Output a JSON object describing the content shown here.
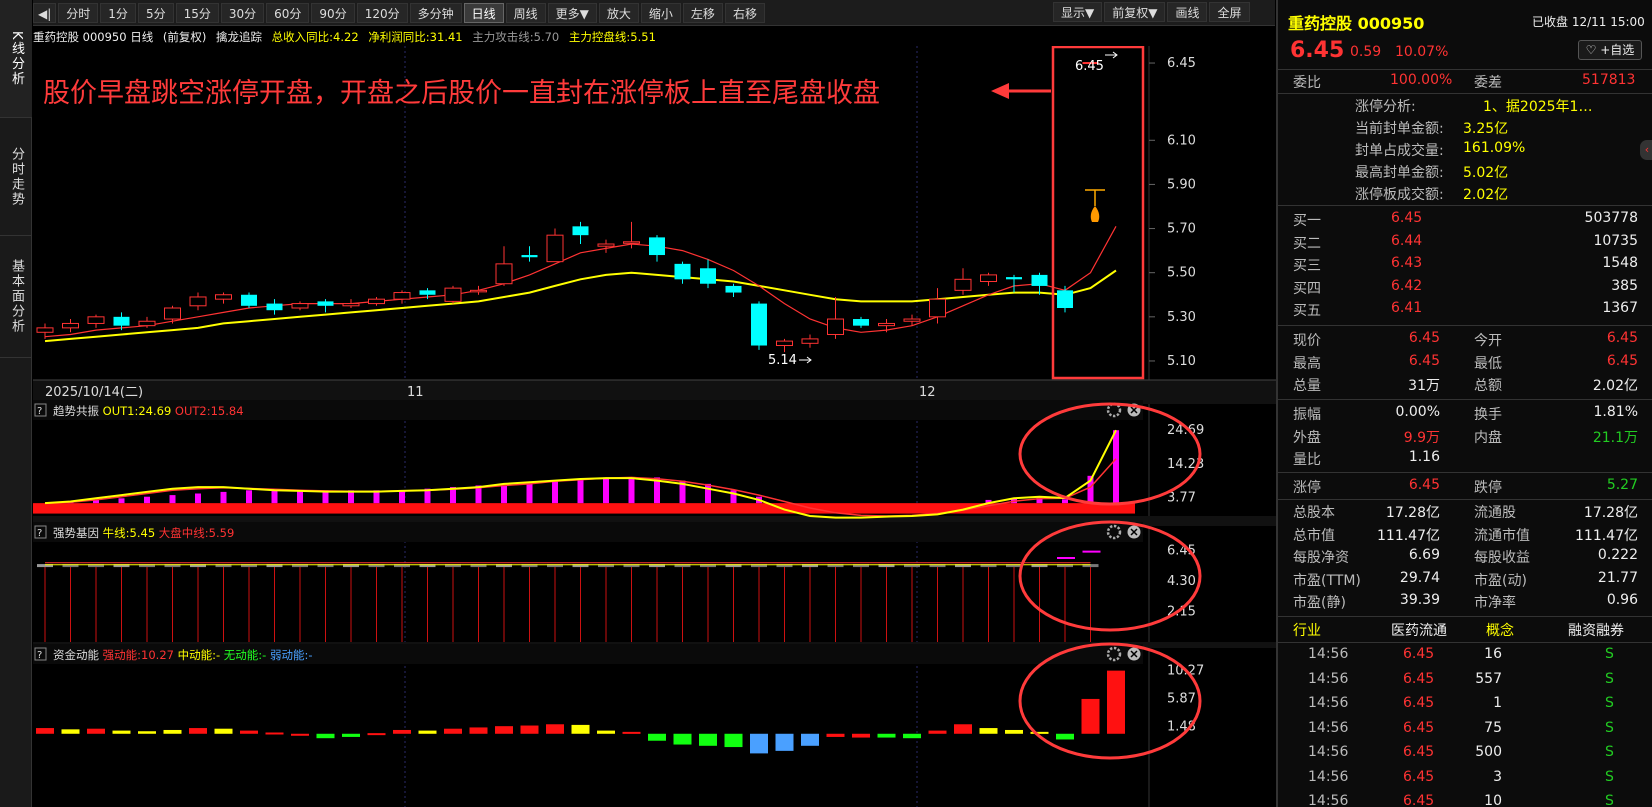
{
  "left_tabs": [
    "K线分析",
    "分时走势",
    "基本面分析"
  ],
  "toolbar": {
    "items": [
      "分时",
      "1分",
      "5分",
      "15分",
      "30分",
      "60分",
      "90分",
      "120分",
      "多分钟",
      "日线",
      "周线",
      "更多▼",
      "放大",
      "缩小",
      "左移",
      "右移"
    ],
    "active": "日线",
    "right_items": [
      "显示▼",
      "前复权▼",
      "画线",
      "全屏"
    ]
  },
  "info_bar": {
    "stock": "重药控股 000950 日线",
    "adjust": "(前复权)",
    "indicator": "擒龙追踪",
    "revenue_yoy": "总收入同比:4.22",
    "profit_yoy": "净利润同比:31.41",
    "attack_line": "主力攻击线:5.70",
    "control_line": "主力控盘线:5.51"
  },
  "annotation": "股价早盘跳空涨停开盘，开盘之后股价一直封在涨停板上直至尾盘收盘",
  "colors": {
    "up": "#ff3333",
    "down": "#00ffff",
    "ma_fast": "#ff3333",
    "ma_slow": "#ffff00",
    "annotation": "#ff3b3b",
    "magenta": "#ff00ff",
    "background": "#000000"
  },
  "chart_data": [
    {
      "type": "candlestick",
      "title": "重药控股 000950 日线",
      "x_labels": [
        "2025/10/14(二)",
        "11",
        "12"
      ],
      "y_ticks": [
        6.45,
        6.1,
        5.9,
        5.7,
        5.5,
        5.3,
        5.1
      ],
      "ylim": [
        5.05,
        6.5
      ],
      "low_label": "5.14",
      "high_label": "6.45",
      "candles": [
        [
          5.23,
          5.25,
          5.2,
          5.27
        ],
        [
          5.25,
          5.27,
          5.23,
          5.29
        ],
        [
          5.27,
          5.3,
          5.25,
          5.31
        ],
        [
          5.3,
          5.26,
          5.24,
          5.32
        ],
        [
          5.26,
          5.28,
          5.25,
          5.3
        ],
        [
          5.29,
          5.34,
          5.27,
          5.35
        ],
        [
          5.35,
          5.39,
          5.33,
          5.41
        ],
        [
          5.38,
          5.4,
          5.36,
          5.41
        ],
        [
          5.4,
          5.35,
          5.34,
          5.41
        ],
        [
          5.36,
          5.33,
          5.31,
          5.38
        ],
        [
          5.34,
          5.36,
          5.33,
          5.37
        ],
        [
          5.37,
          5.35,
          5.32,
          5.38
        ],
        [
          5.35,
          5.36,
          5.34,
          5.38
        ],
        [
          5.36,
          5.38,
          5.35,
          5.39
        ],
        [
          5.38,
          5.41,
          5.36,
          5.42
        ],
        [
          5.42,
          5.4,
          5.38,
          5.43
        ],
        [
          5.37,
          5.43,
          5.36,
          5.44
        ],
        [
          5.42,
          5.42,
          5.4,
          5.44
        ],
        [
          5.45,
          5.54,
          5.44,
          5.62
        ],
        [
          5.58,
          5.57,
          5.55,
          5.62
        ],
        [
          5.55,
          5.67,
          5.55,
          5.7
        ],
        [
          5.71,
          5.67,
          5.63,
          5.73
        ],
        [
          5.62,
          5.63,
          5.59,
          5.65
        ],
        [
          5.64,
          5.64,
          5.61,
          5.73
        ],
        [
          5.66,
          5.58,
          5.55,
          5.67
        ],
        [
          5.54,
          5.47,
          5.45,
          5.55
        ],
        [
          5.52,
          5.45,
          5.43,
          5.56
        ],
        [
          5.44,
          5.41,
          5.39,
          5.45
        ],
        [
          5.36,
          5.17,
          5.15,
          5.37
        ],
        [
          5.17,
          5.19,
          5.14,
          5.2
        ],
        [
          5.18,
          5.2,
          5.16,
          5.22
        ],
        [
          5.22,
          5.29,
          5.2,
          5.39
        ],
        [
          5.29,
          5.26,
          5.25,
          5.3
        ],
        [
          5.26,
          5.27,
          5.23,
          5.29
        ],
        [
          5.28,
          5.29,
          5.26,
          5.31
        ],
        [
          5.3,
          5.38,
          5.27,
          5.43
        ],
        [
          5.42,
          5.47,
          5.4,
          5.52
        ],
        [
          5.46,
          5.49,
          5.44,
          5.5
        ],
        [
          5.48,
          5.47,
          5.41,
          5.49
        ],
        [
          5.49,
          5.44,
          5.4,
          5.5
        ],
        [
          5.42,
          5.34,
          5.32,
          5.44
        ],
        [
          6.45,
          6.45,
          6.45,
          6.45
        ]
      ],
      "ma_fast": [
        5.21,
        5.22,
        5.24,
        5.25,
        5.26,
        5.28,
        5.3,
        5.32,
        5.34,
        5.35,
        5.36,
        5.36,
        5.36,
        5.37,
        5.38,
        5.39,
        5.4,
        5.42,
        5.45,
        5.49,
        5.54,
        5.59,
        5.61,
        5.63,
        5.62,
        5.6,
        5.56,
        5.51,
        5.44,
        5.36,
        5.29,
        5.25,
        5.23,
        5.24,
        5.26,
        5.3,
        5.35,
        5.4,
        5.44,
        5.45,
        5.42,
        5.5,
        5.71
      ],
      "ma_slow": [
        5.19,
        5.2,
        5.21,
        5.22,
        5.23,
        5.24,
        5.25,
        5.27,
        5.28,
        5.29,
        5.3,
        5.31,
        5.32,
        5.33,
        5.34,
        5.35,
        5.36,
        5.37,
        5.39,
        5.41,
        5.44,
        5.47,
        5.49,
        5.5,
        5.49,
        5.48,
        5.47,
        5.46,
        5.44,
        5.42,
        5.4,
        5.38,
        5.37,
        5.37,
        5.37,
        5.38,
        5.39,
        5.4,
        5.41,
        5.41,
        5.4,
        5.43,
        5.51
      ]
    },
    {
      "type": "bar",
      "title": "趋势共振",
      "series": [
        {
          "name": "OUT1",
          "label": "OUT1:24.69"
        },
        {
          "name": "OUT2",
          "label": "OUT2:15.84"
        }
      ],
      "y_ticks": [
        24.69,
        14.23,
        3.77
      ],
      "ylim": [
        -2,
        26
      ],
      "bars": [
        2,
        2.5,
        3,
        3.5,
        4,
        4.5,
        5,
        5.5,
        6,
        6,
        6,
        6,
        6,
        6,
        6,
        6.5,
        7,
        7.5,
        8,
        8.5,
        9,
        9.5,
        10,
        10,
        10,
        9,
        8,
        6,
        4,
        2,
        0,
        0,
        0,
        0,
        0,
        1,
        2,
        3,
        3.5,
        3.8,
        3.2,
        10.5,
        24.69
      ],
      "out1": [
        2,
        2.5,
        3.5,
        4.5,
        5.5,
        6.5,
        7,
        7,
        6.5,
        6,
        5.8,
        5.6,
        5.6,
        5.6,
        5.8,
        6,
        6.5,
        7,
        8,
        8.5,
        9,
        9.5,
        9.8,
        9.8,
        9,
        8,
        6.5,
        5,
        3,
        0,
        -2,
        -2.5,
        -2.5,
        -2.2,
        -2,
        -1.5,
        0,
        2,
        3.5,
        4,
        3.6,
        9,
        24.69
      ],
      "out2": [
        2,
        2.3,
        3,
        4,
        5,
        6,
        6.5,
        6.8,
        6.6,
        6.3,
        6,
        5.8,
        5.7,
        5.7,
        5.8,
        6,
        6.3,
        6.8,
        7.5,
        8,
        8.8,
        9.3,
        9.8,
        10,
        9.6,
        8.8,
        7.6,
        6.2,
        4.5,
        2.5,
        0.5,
        -1,
        -1.8,
        -2,
        -1.8,
        -1.2,
        -0.2,
        1.2,
        2.6,
        3.4,
        3.5,
        7,
        15.84
      ]
    },
    {
      "type": "bar",
      "title": "强势基因",
      "series": [
        {
          "name": "牛线",
          "label": "牛线:5.45"
        },
        {
          "name": "大盘中线",
          "label": "大盘中线:5.59"
        }
      ],
      "y_ticks": [
        6.45,
        4.3,
        2.15
      ],
      "ylim": [
        0,
        7.2
      ]
    },
    {
      "type": "bar",
      "title": "资金动能",
      "series": [
        {
          "name": "强动能",
          "label": "强动能:10.27"
        },
        {
          "name": "中动能",
          "label": "中动能:-"
        },
        {
          "name": "无动能",
          "label": "无动能:-"
        },
        {
          "name": "弱动能",
          "label": "弱动能:-"
        }
      ],
      "y_ticks": [
        10.27,
        5.87,
        1.48
      ],
      "ylim": [
        -4,
        11
      ],
      "bars": [
        1.2,
        1.0,
        1.1,
        0.8,
        0.7,
        0.9,
        1.2,
        1.1,
        0.8,
        0.5,
        0.3,
        -0.4,
        -0.2,
        0.4,
        0.9,
        0.8,
        1.1,
        1.3,
        1.5,
        1.6,
        1.8,
        1.7,
        0.8,
        0.6,
        -0.8,
        -1.4,
        -1.6,
        -1.8,
        -2.8,
        -2.4,
        -1.6,
        -0.2,
        -0.3,
        -0.3,
        -0.4,
        0.8,
        1.8,
        1.2,
        0.9,
        0.6,
        -0.6,
        5.8,
        10.27
      ],
      "bar_colors": [
        "r",
        "y",
        "r",
        "y",
        "y",
        "y",
        "r",
        "y",
        "r",
        "r",
        "r",
        "g",
        "g",
        "r",
        "r",
        "y",
        "r",
        "r",
        "r",
        "r",
        "r",
        "y",
        "y",
        "r",
        "g",
        "g",
        "g",
        "g",
        "b",
        "b",
        "b",
        "r",
        "r",
        "g",
        "g",
        "r",
        "r",
        "y",
        "y",
        "y",
        "g",
        "r",
        "r"
      ]
    }
  ],
  "quote": {
    "name": "重药控股 000950",
    "status": "已收盘 12/11 15:00",
    "price": "6.45",
    "change": "0.59",
    "pct": "10.07%",
    "follow": "+自选",
    "weibi_label": "委比",
    "weibi": "100.00%",
    "weicha_label": "委差",
    "weicha": "517813",
    "limit_analysis": [
      {
        "label": "涨停分析:",
        "value": "1、据2025年1…"
      },
      {
        "label": "当前封单金额:",
        "value": "3.25亿"
      },
      {
        "label": "封单占成交量:",
        "value": "161.09%"
      },
      {
        "label": "最高封单金额:",
        "value": "5.02亿"
      },
      {
        "label": "涨停板成交额:",
        "value": "2.02亿"
      }
    ],
    "bids": [
      {
        "label": "买一",
        "price": "6.45",
        "vol": "503778"
      },
      {
        "label": "买二",
        "price": "6.44",
        "vol": "10735"
      },
      {
        "label": "买三",
        "price": "6.43",
        "vol": "1548"
      },
      {
        "label": "买四",
        "price": "6.42",
        "vol": "385"
      },
      {
        "label": "买五",
        "price": "6.41",
        "vol": "1367"
      }
    ],
    "stats1": [
      {
        "l1": "现价",
        "v1": "6.45",
        "c1": "red",
        "l2": "今开",
        "v2": "6.45",
        "c2": "red"
      },
      {
        "l1": "最高",
        "v1": "6.45",
        "c1": "red",
        "l2": "最低",
        "v2": "6.45",
        "c2": "red"
      },
      {
        "l1": "总量",
        "v1": "31万",
        "c1": "white",
        "l2": "总额",
        "v2": "2.02亿",
        "c2": "white"
      }
    ],
    "stats2": [
      {
        "l1": "振幅",
        "v1": "0.00%",
        "c1": "white",
        "l2": "换手",
        "v2": "1.81%",
        "c2": "white"
      },
      {
        "l1": "外盘",
        "v1": "9.9万",
        "c1": "red",
        "l2": "内盘",
        "v2": "21.1万",
        "c2": "green"
      },
      {
        "l1": "量比",
        "v1": "1.16",
        "c1": "white",
        "l2": "",
        "v2": "",
        "c2": "white"
      }
    ],
    "stats3": [
      {
        "l1": "涨停",
        "v1": "6.45",
        "c1": "red",
        "l2": "跌停",
        "v2": "5.27",
        "c2": "green"
      }
    ],
    "stats4": [
      {
        "l1": "总股本",
        "v1": "17.28亿",
        "c1": "white",
        "l2": "流通股",
        "v2": "17.28亿",
        "c2": "white"
      },
      {
        "l1": "总市值",
        "v1": "111.47亿",
        "c1": "white",
        "l2": "流通市值",
        "v2": "111.47亿",
        "c2": "white"
      },
      {
        "l1": "每股净资",
        "v1": "6.69",
        "c1": "white",
        "l2": "每股收益",
        "v2": "0.222",
        "c2": "white"
      },
      {
        "l1": "市盈(TTM)",
        "v1": "29.74",
        "c1": "white",
        "l2": "市盈(动)",
        "v2": "21.77",
        "c2": "white"
      },
      {
        "l1": "市盈(静)",
        "v1": "39.39",
        "c1": "white",
        "l2": "市净率",
        "v2": "0.96",
        "c2": "white"
      }
    ],
    "tags": {
      "industry_label": "行业",
      "industry": "医药流通",
      "concept_label": "概念",
      "margin": "融资融券"
    },
    "ticks": [
      {
        "time": "14:56",
        "price": "6.45",
        "vol": "16",
        "side": "S"
      },
      {
        "time": "14:56",
        "price": "6.45",
        "vol": "557",
        "side": "S"
      },
      {
        "time": "14:56",
        "price": "6.45",
        "vol": "1",
        "side": "S"
      },
      {
        "time": "14:56",
        "price": "6.45",
        "vol": "75",
        "side": "S"
      },
      {
        "time": "14:56",
        "price": "6.45",
        "vol": "500",
        "side": "S"
      },
      {
        "time": "14:56",
        "price": "6.45",
        "vol": "3",
        "side": "S"
      },
      {
        "time": "14:56",
        "price": "6.45",
        "vol": "10",
        "side": "S"
      }
    ]
  }
}
